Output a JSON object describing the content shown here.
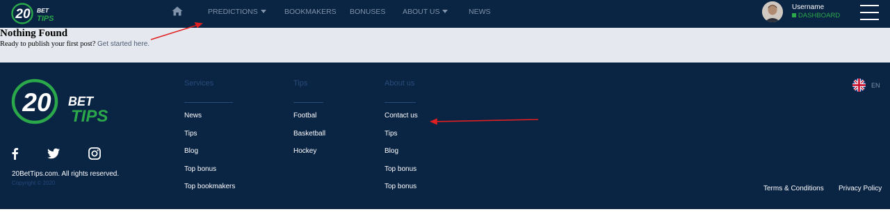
{
  "header": {
    "nav": [
      {
        "label": "PREDICTIONS",
        "dropdown": true
      },
      {
        "label": "BOOKMAKERS",
        "dropdown": false
      },
      {
        "label": "BONUSES",
        "dropdown": false
      },
      {
        "label": "ABOUT US",
        "dropdown": true
      },
      {
        "label": "NEWS",
        "dropdown": false
      }
    ],
    "user": {
      "name": "Username",
      "dashboard_label": "DASHBOARD"
    }
  },
  "logo": {
    "number": "20",
    "word1": "BET",
    "word2": "TIPS"
  },
  "content": {
    "title": "Nothing Found",
    "text": "Ready to publish your first post?",
    "link": "Get started here."
  },
  "footer": {
    "columns": [
      {
        "heading": "Services",
        "links": [
          "News",
          "Tips",
          "Blog",
          "Top bonus",
          "Top bookmakers"
        ]
      },
      {
        "heading": "Tips",
        "links": [
          "Footbal",
          "Basketball",
          "Hockey"
        ]
      },
      {
        "heading": "About us",
        "links": [
          "Contact us",
          "Tips",
          "Blog",
          "Top bonus",
          "Top bonus"
        ]
      }
    ],
    "social": [
      "facebook-icon",
      "twitter-icon",
      "instagram-icon"
    ],
    "rights": "20BetTips.com. All rights reserved.",
    "copyright": "Copyright © 2020",
    "language": "EN",
    "bottom_links": [
      "Terms & Conditions",
      "Privacy Policy"
    ]
  },
  "colors": {
    "navy": "#0a2444",
    "green": "#2aa84a",
    "content_bg": "#e5e8ef",
    "annotation": "#e02020"
  }
}
